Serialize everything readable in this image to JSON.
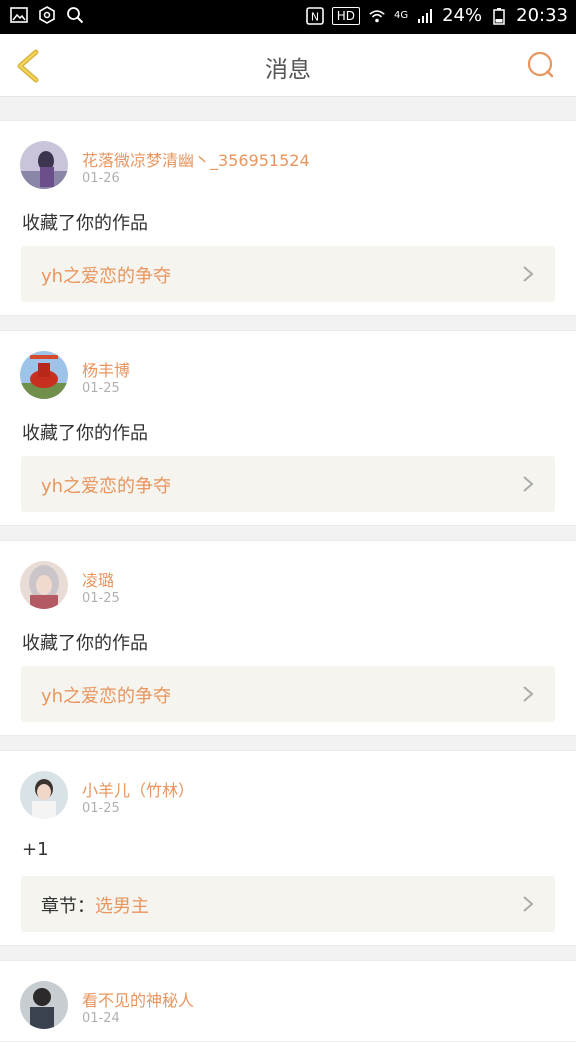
{
  "status_bar": {
    "battery": "24%",
    "time": "20:33",
    "network": "4G",
    "hd": "HD"
  },
  "header": {
    "title": "消息"
  },
  "messages": [
    {
      "name": "花落微凉梦清幽丶_356951524",
      "date": "01-26",
      "content": "收藏了你的作品",
      "work_prefix": "",
      "work": "yh之爱恋的争夺"
    },
    {
      "name": "杨丰博",
      "date": "01-25",
      "content": "收藏了你的作品",
      "work_prefix": "",
      "work": "yh之爱恋的争夺"
    },
    {
      "name": "凌璐",
      "date": "01-25",
      "content": "收藏了你的作品",
      "work_prefix": "",
      "work": "yh之爱恋的争夺"
    },
    {
      "name": "小羊儿（竹林）",
      "date": "01-25",
      "content": "+1",
      "work_prefix": "章节：",
      "work": "选男主"
    },
    {
      "name": "看不见的神秘人",
      "date": "01-24"
    }
  ],
  "colors": {
    "accent": "#e8955e",
    "back_icon": "#e8c34a",
    "card_box": "#f5f4ee"
  }
}
